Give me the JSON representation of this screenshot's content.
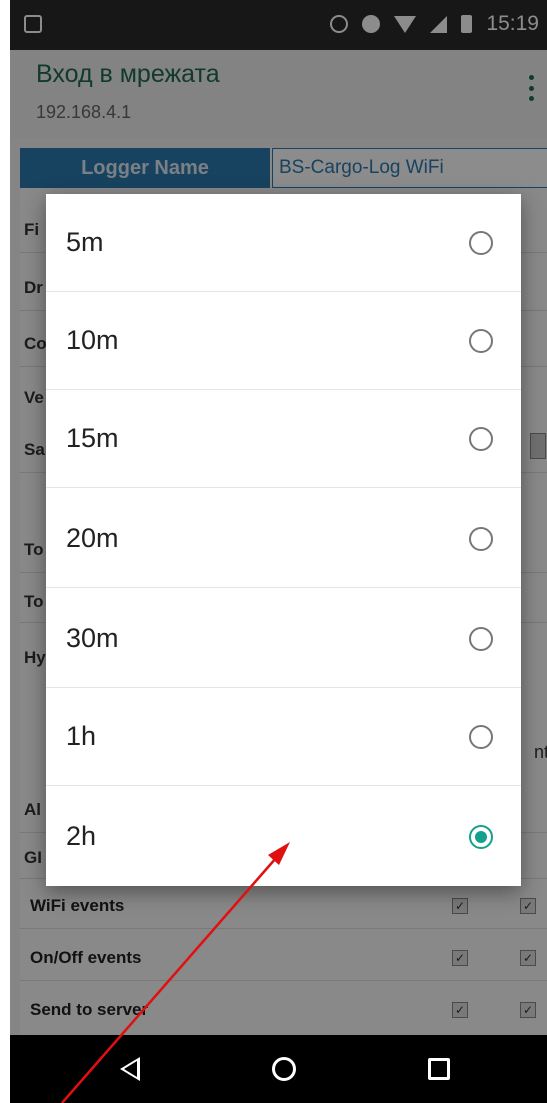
{
  "status_bar": {
    "time": "15:19",
    "icons": [
      "image-icon",
      "data-saver-icon",
      "alarm-icon",
      "wifi-icon",
      "signal-icon",
      "battery-icon"
    ]
  },
  "app_bar": {
    "title": "Вход в мрежата",
    "subtitle": "192.168.4.1",
    "menu_icon": "more-vert-icon"
  },
  "background_page": {
    "logger_name_label": "Logger Name",
    "logger_name_value": "BS-Cargo-Log WiFi",
    "row_labels": [
      "Fi",
      "Dr",
      "Co",
      "Ve",
      "Sa",
      "To",
      "To",
      "Hy",
      "Al",
      "GI"
    ],
    "column_fragment": "nt",
    "events": [
      "WiFi events",
      "On/Off events",
      "Send to server"
    ]
  },
  "dialog": {
    "options": [
      {
        "label": "5m",
        "selected": false
      },
      {
        "label": "10m",
        "selected": false
      },
      {
        "label": "15m",
        "selected": false
      },
      {
        "label": "20m",
        "selected": false
      },
      {
        "label": "30m",
        "selected": false
      },
      {
        "label": "1h",
        "selected": false
      },
      {
        "label": "2h",
        "selected": true
      }
    ],
    "accent_color": "#14a08e"
  },
  "nav_bar": {
    "icons": [
      "back-icon",
      "home-icon",
      "recents-icon"
    ]
  },
  "annotation": {
    "color": "#e01010"
  }
}
